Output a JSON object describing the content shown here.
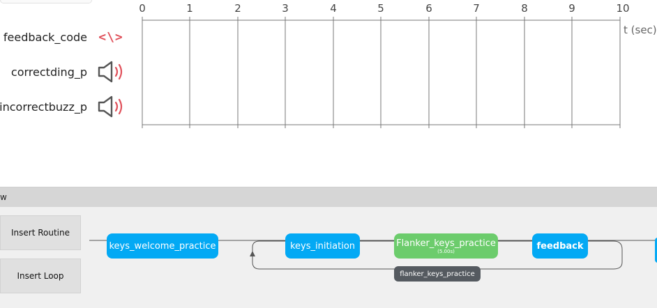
{
  "routine_timeline": {
    "components": [
      {
        "name": "feedback_code",
        "icon": "code-icon",
        "glyph": "<\\>"
      },
      {
        "name": "correctding_p",
        "icon": "speaker-icon"
      },
      {
        "name": "incorrectbuzz_p",
        "icon": "speaker-icon"
      }
    ],
    "time_ticks": [
      "0",
      "1",
      "2",
      "3",
      "4",
      "5",
      "6",
      "7",
      "8",
      "9",
      "10"
    ],
    "time_unit": "t (sec)"
  },
  "flow": {
    "title": "w",
    "buttons": {
      "insert_routine": "Insert Routine",
      "insert_loop": "Insert Loop"
    },
    "routines": [
      {
        "name": "keys_welcome_practice",
        "color": "#03a9f4"
      },
      {
        "name": "keys_initiation",
        "color": "#03a9f4"
      },
      {
        "name": "Flanker_keys_practice",
        "duration": "(5.00s)",
        "color": "#6ccc6c"
      },
      {
        "name": "feedback",
        "color": "#03a9f4"
      }
    ],
    "loop": {
      "name": "flanker_keys_practice"
    }
  },
  "colors": {
    "routine_blue": "#03a9f4",
    "routine_green": "#6ccc6c",
    "code_red": "#e0505a",
    "loop_gray": "#555a60"
  }
}
